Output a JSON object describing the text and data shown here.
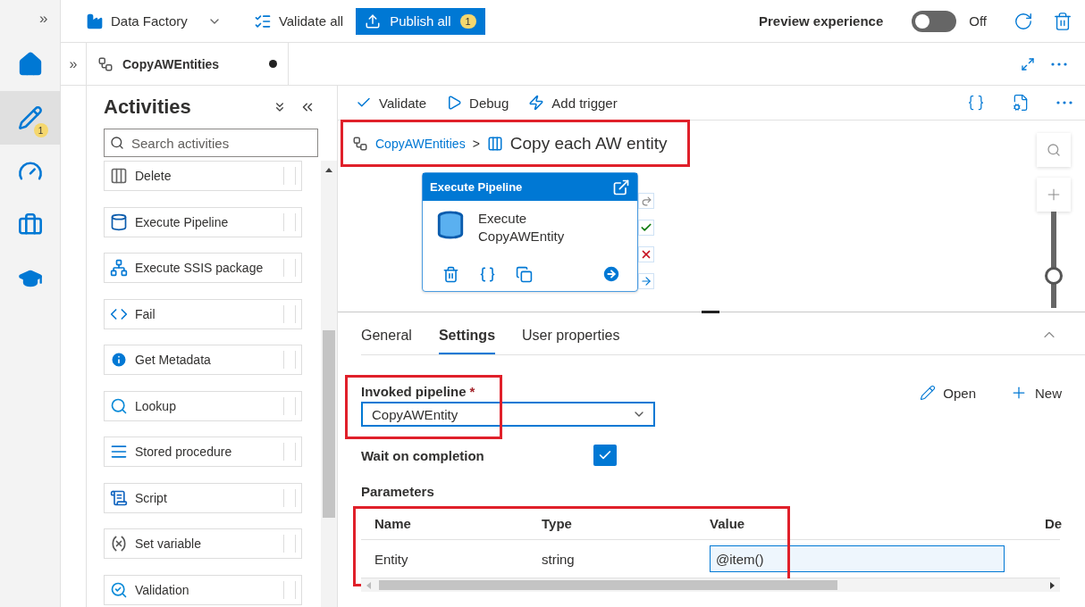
{
  "left_nav": {
    "expand": "»",
    "items": [
      {
        "kind": "home",
        "selected": false
      },
      {
        "kind": "author",
        "selected": true,
        "badge": "1"
      },
      {
        "kind": "monitor",
        "selected": false
      },
      {
        "kind": "manage",
        "selected": false
      },
      {
        "kind": "learn",
        "selected": false
      }
    ]
  },
  "top_bar": {
    "factory": "Data Factory",
    "validate_all": "Validate all",
    "publish_all": "Publish all",
    "publish_count": "1",
    "preview_label": "Preview experience",
    "preview_toggle": {
      "on": false,
      "label": "Off"
    }
  },
  "tab_strip": {
    "expand": "»",
    "tabs": [
      {
        "label": "CopyAWEntities",
        "selected": true,
        "unsaved": true
      }
    ]
  },
  "activities": {
    "title": "Activities",
    "search_placeholder": "Search activities",
    "items": [
      {
        "label": "Delete",
        "kind": "delete"
      },
      {
        "label": "Execute Pipeline",
        "kind": "execute"
      },
      {
        "label": "Execute SSIS package",
        "kind": "ssis"
      },
      {
        "label": "Fail",
        "kind": "fail"
      },
      {
        "label": "Get Metadata",
        "kind": "metadata"
      },
      {
        "label": "Lookup",
        "kind": "lookup"
      },
      {
        "label": "Stored procedure",
        "kind": "procedure"
      },
      {
        "label": "Script",
        "kind": "script"
      },
      {
        "label": "Set variable",
        "kind": "variable"
      },
      {
        "label": "Validation",
        "kind": "validation"
      }
    ]
  },
  "toolbar": {
    "validate": "Validate",
    "debug": "Debug",
    "add_trigger": "Add trigger"
  },
  "breadcrumb": {
    "pipeline": "CopyAWEntities",
    "separator": ">",
    "current": "Copy each AW entity"
  },
  "node": {
    "header": "Execute Pipeline",
    "name": "Execute CopyAWEntity"
  },
  "canvas_zoom": {
    "level": 0.3
  },
  "properties": {
    "tabs": [
      {
        "label": "General",
        "selected": false
      },
      {
        "label": "Settings",
        "selected": true
      },
      {
        "label": "User properties",
        "selected": false
      }
    ],
    "invoked_pipeline": {
      "label": "Invoked pipeline",
      "required": "*",
      "value": "CopyAWEntity"
    },
    "open": "Open",
    "new": "New",
    "wait_on_completion": {
      "label": "Wait on completion",
      "checked": true
    },
    "parameters": {
      "title": "Parameters",
      "columns": [
        "Name",
        "Type",
        "Value",
        "De"
      ],
      "rows": [
        {
          "name": "Entity",
          "type": "string",
          "value": "@item()"
        }
      ]
    }
  }
}
